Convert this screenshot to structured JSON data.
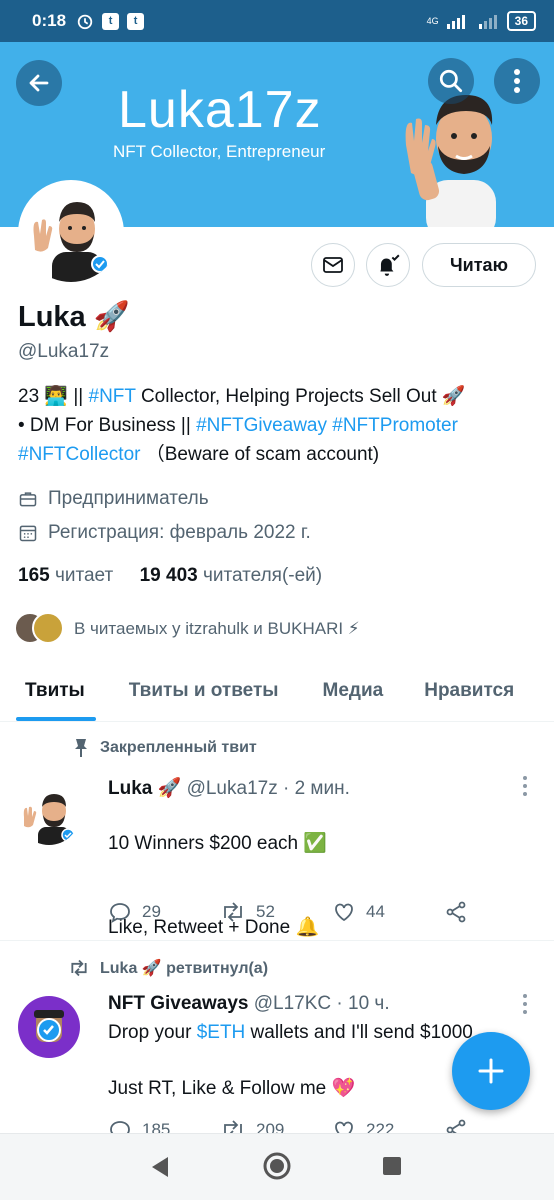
{
  "status_bar": {
    "time": "0:18",
    "network": "4G",
    "battery": "36"
  },
  "banner": {
    "title": "Luka17z",
    "subtitle": "NFT Collector, Entrepreneur"
  },
  "profile": {
    "follow_label": "Читаю",
    "name": "Luka 🚀",
    "handle": "@Luka17z",
    "bio": {
      "l1a": "23 👨‍💻 || ",
      "l1b": "#NFT",
      "l1c": " Collector, Helping Projects Sell Out 🚀",
      "l2a": "• DM For Business || ",
      "l2b": "#NFTGiveaway",
      "l2c": " ",
      "l2d": "#NFTPromoter",
      "l3a": "#NFTCollector",
      "l3b": " （Beware of scam account)"
    },
    "profession": "Предприниматель",
    "joined": "Регистрация: февраль 2022 г.",
    "following_count": "165",
    "following_label": "читает",
    "followers_count": "19 403",
    "followers_label": "читателя(-ей)",
    "followed_by": "В читаемых у itzrahulk и BUKHARI ⚡"
  },
  "tabs": [
    "Твиты",
    "Твиты и ответы",
    "Медиа",
    "Нравится"
  ],
  "tweets": [
    {
      "context": "Закрепленный твит",
      "name": "Luka 🚀",
      "handle": "@Luka17z",
      "time": "· 2 мин.",
      "line1": "10 Winners $200 each ✅",
      "line2": "Like, Retweet + Done 🔔",
      "replies": "29",
      "retweets": "52",
      "likes": "44"
    },
    {
      "context": "Luka 🚀 ретвитнул(а)",
      "name": "NFT Giveaways",
      "handle": "@L17KC",
      "time": "· 10 ч.",
      "line1a": "Drop your ",
      "line1b": "$ETH",
      "line1c": " wallets and I'll send $1000",
      "line2": "Just RT, Like & Follow me 💖",
      "replies": "185",
      "retweets": "209",
      "likes": "222"
    }
  ],
  "colors": {
    "accent": "#1d9bf0",
    "banner": "#41b0ea",
    "status_bar": "#1d5f8c"
  }
}
